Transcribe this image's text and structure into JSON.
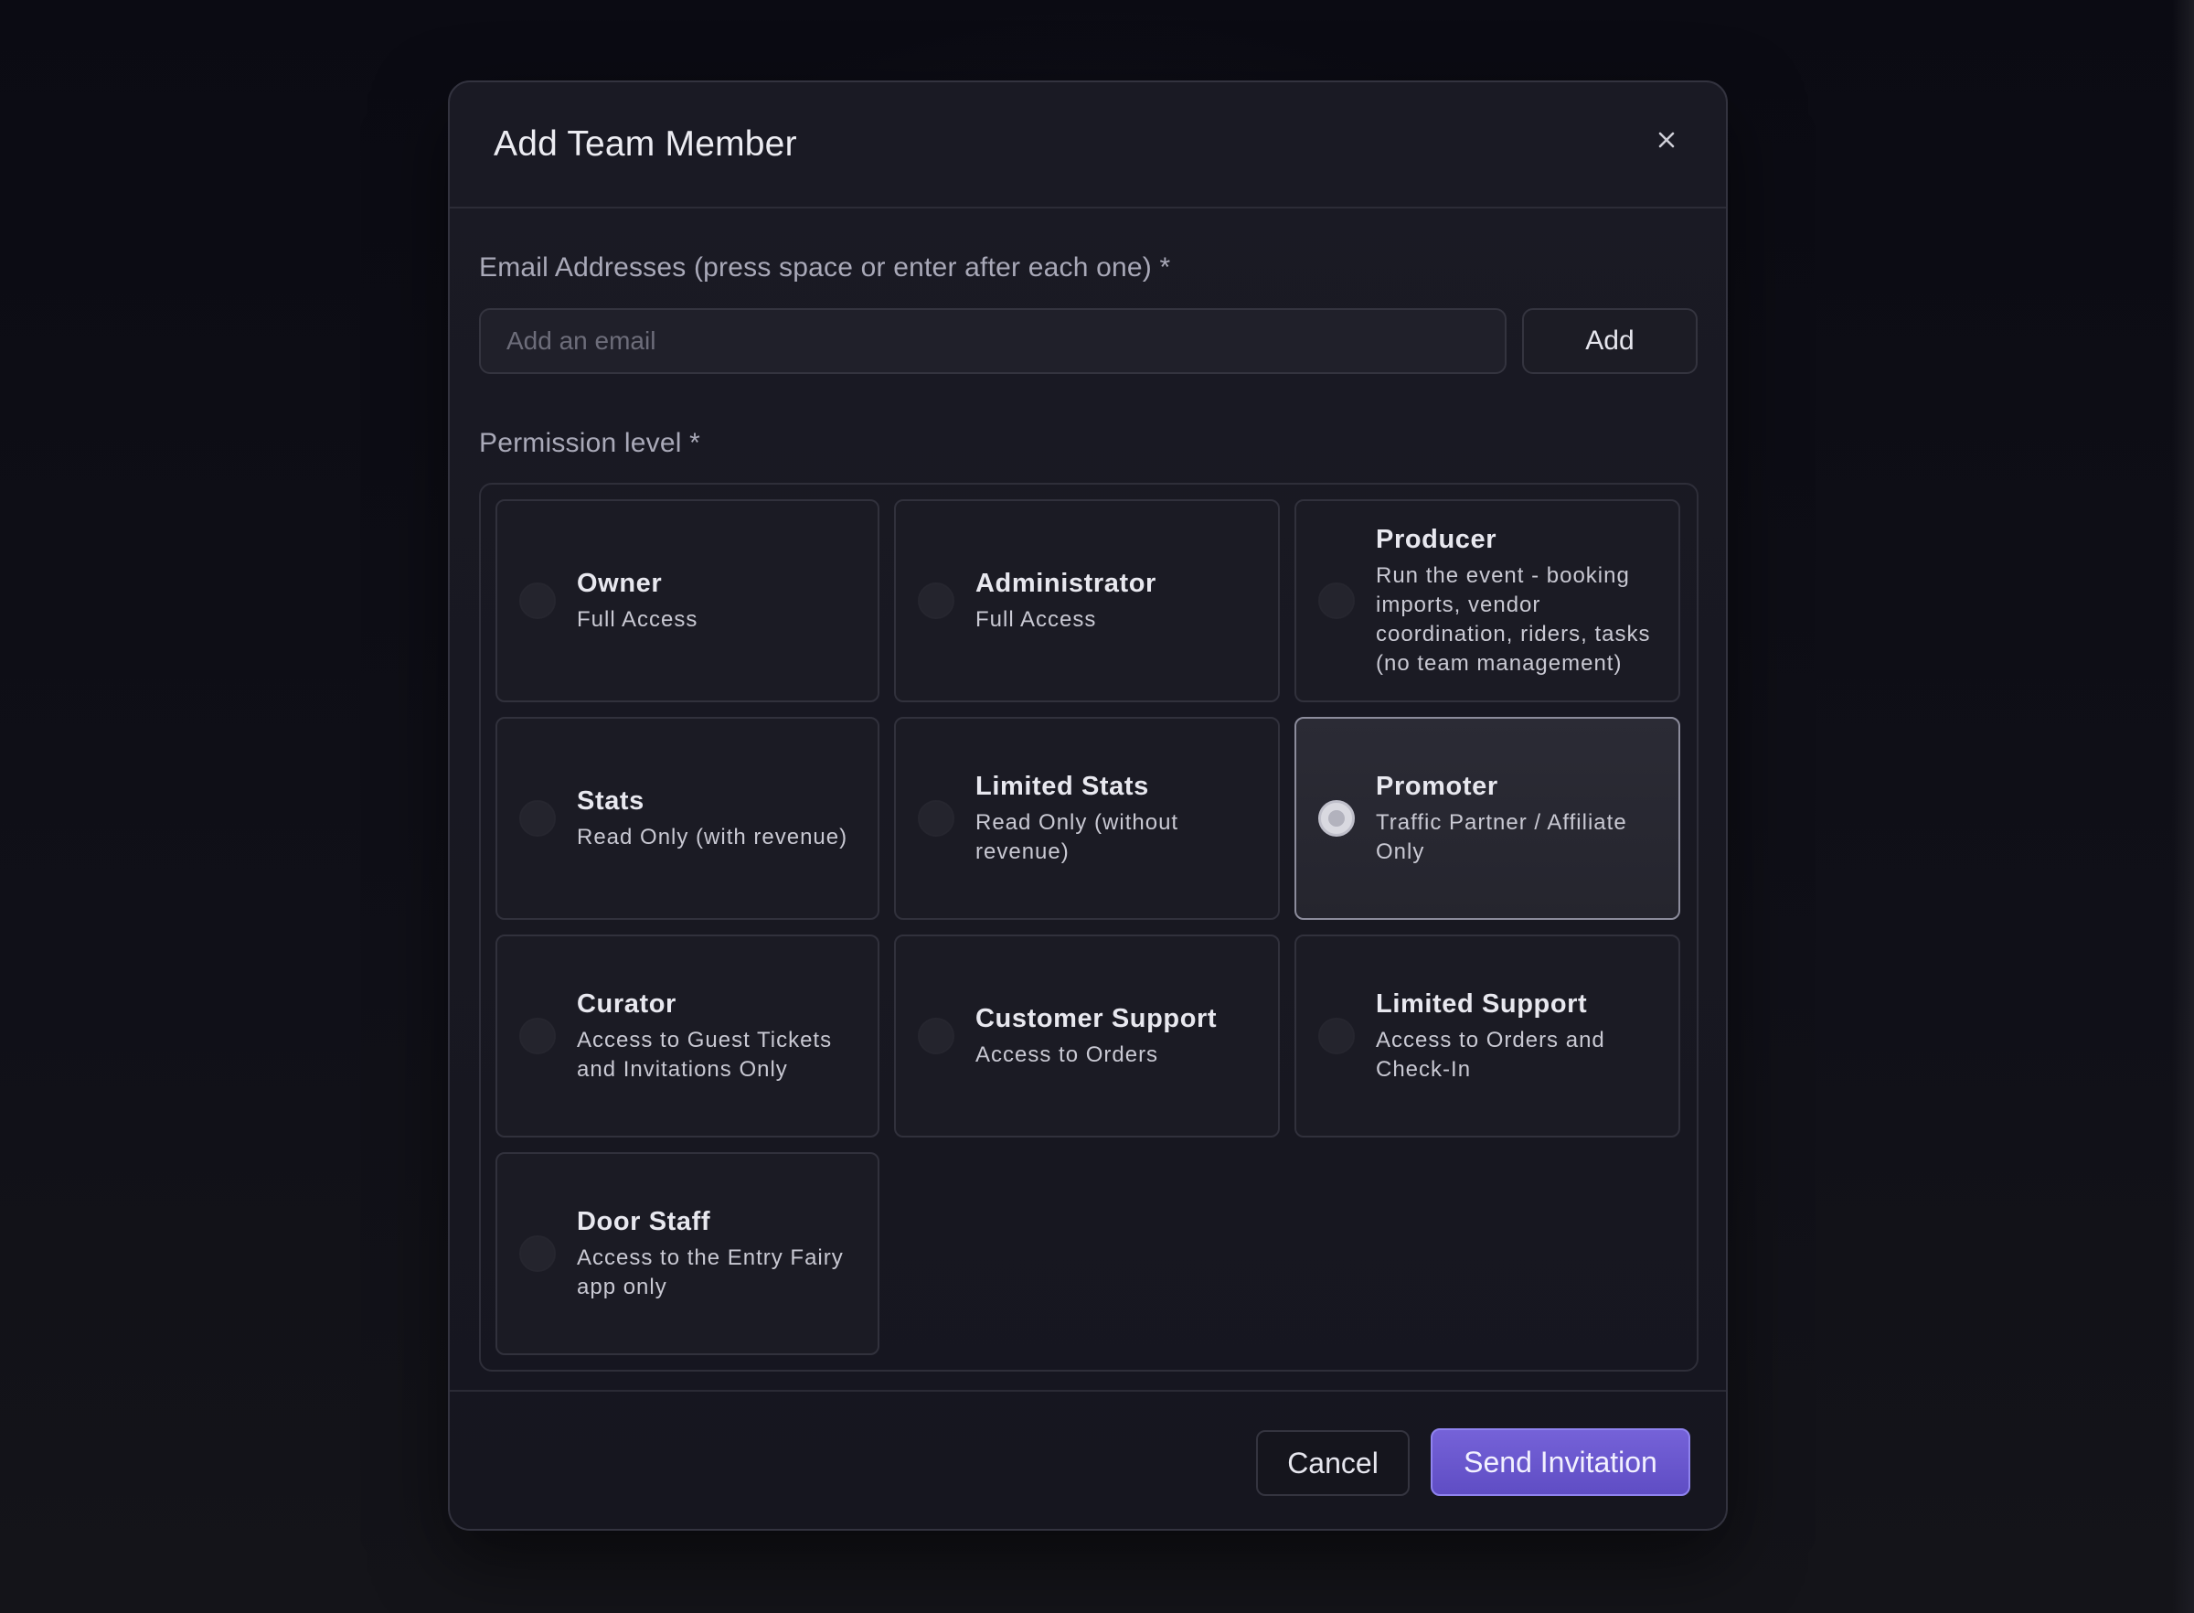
{
  "colors": {
    "accent": "#6b58d0",
    "selected_border": "#8c8c9c"
  },
  "modal": {
    "title": "Add Team Member",
    "close_icon": "close-icon"
  },
  "email": {
    "label": "Email Addresses (press space or enter after each one) *",
    "placeholder": "Add an email",
    "value": "",
    "add_label": "Add"
  },
  "permission": {
    "label": "Permission level *",
    "selected": "Promoter",
    "options": [
      {
        "title": "Owner",
        "desc": "Full Access",
        "selected": false
      },
      {
        "title": "Administrator",
        "desc": "Full Access",
        "selected": false
      },
      {
        "title": "Producer",
        "desc": "Run the event - booking imports, vendor coordination, riders, tasks (no team management)",
        "selected": false
      },
      {
        "title": "Stats",
        "desc": "Read Only (with revenue)",
        "selected": false
      },
      {
        "title": "Limited Stats",
        "desc": "Read Only (without revenue)",
        "selected": false
      },
      {
        "title": "Promoter",
        "desc": "Traffic Partner / Affiliate Only",
        "selected": true
      },
      {
        "title": "Curator",
        "desc": "Access to Guest Tickets and Invitations Only",
        "selected": false
      },
      {
        "title": "Customer Support",
        "desc": "Access to Orders",
        "selected": false
      },
      {
        "title": "Limited Support",
        "desc": "Access to Orders and Check-In",
        "selected": false
      },
      {
        "title": "Door Staff",
        "desc": "Access to the Entry Fairy app only",
        "selected": false
      }
    ]
  },
  "footer": {
    "cancel_label": "Cancel",
    "send_label": "Send Invitation"
  }
}
